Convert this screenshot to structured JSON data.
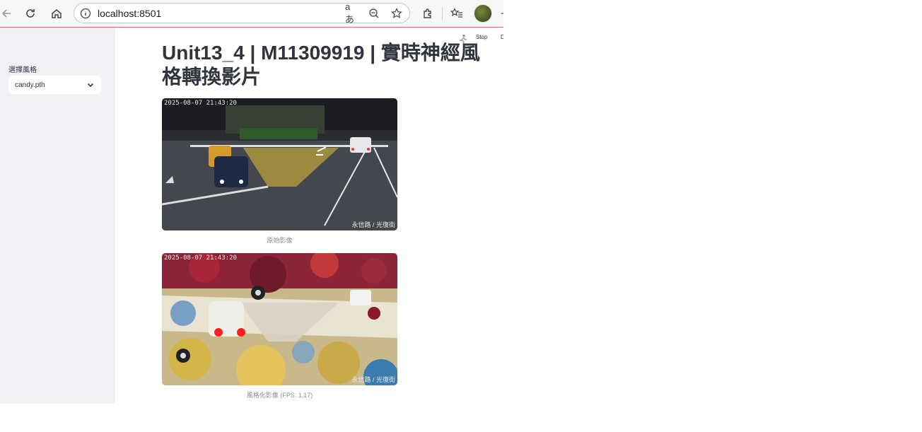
{
  "browser": {
    "url": "localhost:8501",
    "read_aloud_glyph": "aあ"
  },
  "toolbar": {
    "stop_label": "Stop",
    "deploy_label": "D"
  },
  "sidebar": {
    "select_label": "選擇風格",
    "select_value": "candy.pth"
  },
  "main": {
    "title": "Unit13_4 | M11309919 | 實時神經風格轉換影片",
    "original": {
      "timestamp": "2025-08-07 21:43:20",
      "location": "永信路 / 光復街",
      "caption": "原始影像"
    },
    "styled": {
      "timestamp": "2025-08-07 21:43:20",
      "location": "永信路 / 光復街",
      "caption": "風格化影像 (FPS: 1.17)"
    }
  }
}
